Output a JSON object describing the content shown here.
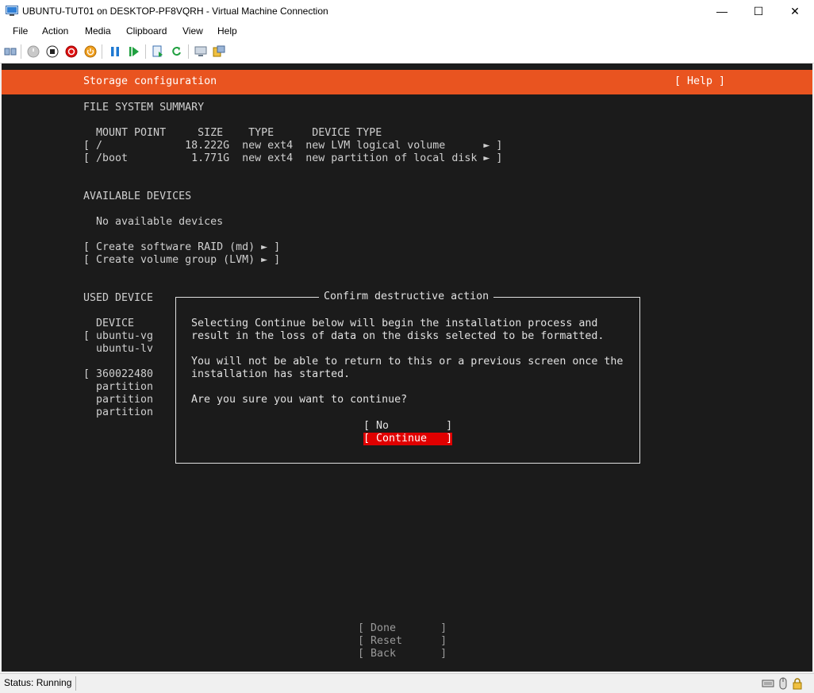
{
  "window": {
    "title": "UBUNTU-TUT01 on DESKTOP-PF8VQRH - Virtual Machine Connection",
    "minimize_label": "—",
    "maximize_label": "☐",
    "close_label": "✕"
  },
  "menu": [
    "File",
    "Action",
    "Media",
    "Clipboard",
    "View",
    "Help"
  ],
  "toolbar_icons": [
    "ctrl-alt-del-icon",
    "start-icon",
    "turn-off-icon",
    "shut-down-icon",
    "save-state-icon",
    "pause-icon",
    "resume-icon",
    "checkpoint-icon",
    "revert-icon",
    "enhanced-session-icon",
    "share-icon"
  ],
  "installer": {
    "header_title": "Storage configuration",
    "help_label": "[ Help ]",
    "fs_summary_heading": "FILE SYSTEM SUMMARY",
    "fs_columns": "  MOUNT POINT     SIZE    TYPE      DEVICE TYPE",
    "fs_rows": [
      "[ /             18.222G  new ext4  new LVM logical volume      ► ]",
      "[ /boot          1.771G  new ext4  new partition of local disk ► ]"
    ],
    "available_heading": "AVAILABLE DEVICES",
    "no_devices": "  No available devices",
    "create_raid": "[ Create software RAID (md) ► ]",
    "create_vg": "[ Create volume group (LVM) ► ]",
    "used_heading": "USED DEVICE",
    "used_lines": [
      "  DEVICE",
      "[ ubuntu-vg",
      "  ubuntu-lv",
      "",
      "[ 360022480",
      "  partition",
      "  partition",
      "  partition"
    ],
    "bottom_buttons": [
      "[ Done       ]",
      "[ Reset      ]",
      "[ Back       ]"
    ]
  },
  "dialog": {
    "title": "Confirm destructive action",
    "line1": "Selecting Continue below will begin the installation process and",
    "line2": "result in the loss of data on the disks selected to be formatted.",
    "line3": "You will not be able to return to this or a previous screen once the",
    "line4": "installation has started.",
    "line5": "Are you sure you want to continue?",
    "no_label": "[ No         ]",
    "continue_label": "[ Continue   ]"
  },
  "status": {
    "text": "Status: Running"
  },
  "colors": {
    "ubuntu_orange": "#e95420",
    "selected_button": "#e00000",
    "terminal_bg": "#1b1b1b"
  }
}
